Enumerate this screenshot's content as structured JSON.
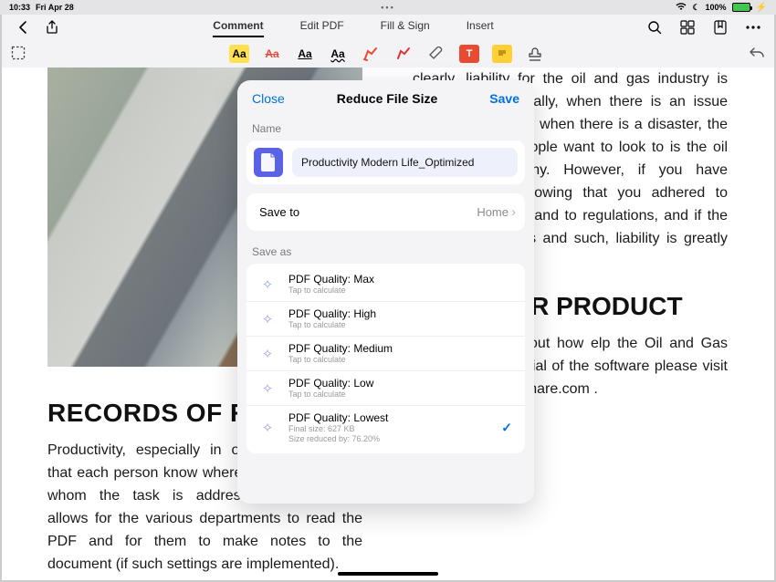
{
  "statusbar": {
    "time": "10:33",
    "date": "Fri Apr 28",
    "center_glyph": "•••",
    "moon": "☾",
    "battery_pct": "100%"
  },
  "topbar": {
    "tabs": {
      "comment": "Comment",
      "edit_pdf": "Edit PDF",
      "fill_sign": "Fill & Sign",
      "insert": "Insert"
    },
    "active_tab": "comment"
  },
  "document": {
    "left_heading": "RECORDS OF RESPON",
    "left_body": "Productivity, especially in operations requires that each person know where they stand and to whom the task is addressed. PDFelement allows for the various departments to read the PDF and for them to make notes to the document (if such settings are implemented).",
    "right_body_top": "clearly, liability for the oil and gas industry is decreased. Generally, when there is an issue with operations, or when there is a disaster, the first place that people want to look to is the oil and gas company. However, if you have documentation showing that you adhered to safety, standards, and to regulations, and if the PDF has sign offs and such, liability is greatly reduced.",
    "right_heading": "BOUT OUR PRODUCT",
    "right_body_bottom": "to know more about how elp the Oil and Gas industry, to try a trial of the software please visit http://pdf.wondershare.com ."
  },
  "modal": {
    "close_label": "Close",
    "title": "Reduce File Size",
    "save_label": "Save",
    "name_label": "Name",
    "filename": "Productivity Modern Life_Optimized",
    "save_to_label": "Save to",
    "save_to_value": "Home",
    "save_as_label": "Save as",
    "tap_to_calculate": "Tap to calculate",
    "quality": {
      "max": {
        "title": "PDF Quality: Max"
      },
      "high": {
        "title": "PDF Quality: High"
      },
      "medium": {
        "title": "PDF Quality: Medium"
      },
      "low": {
        "title": "PDF Quality: Low"
      },
      "lowest": {
        "title": "PDF Quality: Lowest",
        "line1": "Final size: 627 KB",
        "line2": "Size reduced by: 76.20%",
        "selected": true
      }
    }
  }
}
